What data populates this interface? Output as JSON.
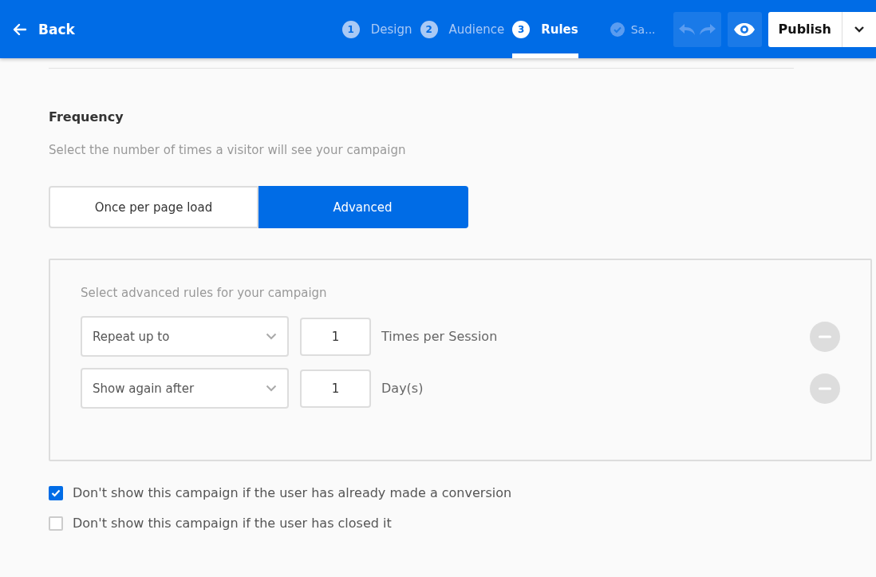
{
  "header": {
    "back": "Back",
    "steps": [
      {
        "number": "1",
        "label": "Design",
        "selected": false
      },
      {
        "number": "2",
        "label": "Audience",
        "selected": false
      },
      {
        "number": "3",
        "label": "Rules",
        "selected": true
      }
    ],
    "save_status": "Sa...",
    "publish": "Publish"
  },
  "frequency": {
    "title": "Frequency",
    "description": "Select the number of times a visitor will see your campaign",
    "options": [
      {
        "label": "Once per page load",
        "selected": false
      },
      {
        "label": "Advanced",
        "selected": true
      }
    ],
    "advanced": {
      "hint": "Select advanced rules for your campaign",
      "rules": [
        {
          "rule": "Repeat up to",
          "value": "1",
          "unit": "Times per Session"
        },
        {
          "rule": "Show again after",
          "value": "1",
          "unit": "Day(s)"
        }
      ]
    }
  },
  "conditions": [
    {
      "label": "Don't show this campaign if the user has already made a conversion",
      "checked": true
    },
    {
      "label": "Don't show this campaign if the user has closed it",
      "checked": false
    }
  ]
}
